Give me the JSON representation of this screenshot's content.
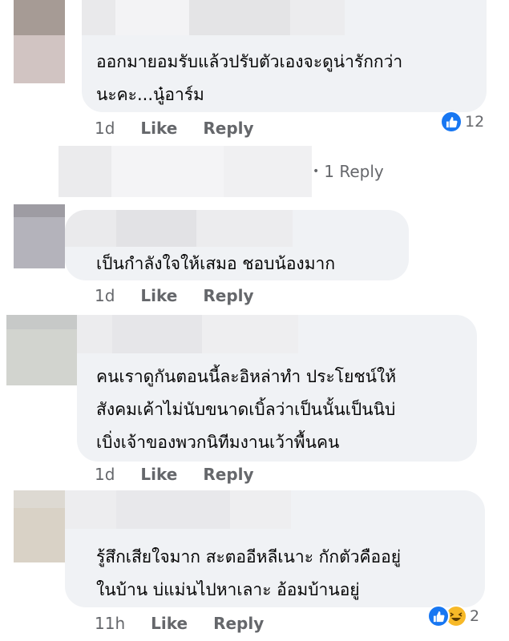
{
  "comments": [
    {
      "text_lines": [
        "ออกมายอมรับแล้วปรับตัวเองจะดูน่ารักกว่า",
        "นะคะ...นู๋อาร์ม"
      ],
      "time": "1d",
      "like_label": "Like",
      "reply_label": "Reply",
      "reactions": [
        "like"
      ],
      "reaction_count": "12",
      "view_replies": "1 Reply"
    },
    {
      "text_lines": [
        "เป็นกำลังใจให้เสมอ ชอบน้องมาก"
      ],
      "time": "1d",
      "like_label": "Like",
      "reply_label": "Reply"
    },
    {
      "text_lines": [
        "คนเราดูกันตอนนี้ละอิหล่าทำ ประโยชน์ให้",
        "สังคมเค้าไม่นับขนาดเบิ้ลว่าเป็นนั้นเป็นนิบ่",
        "เบิ่งเจ้าของพวกนิทีมงานเว้าพื้นคน"
      ],
      "time": "1d",
      "like_label": "Like",
      "reply_label": "Reply"
    },
    {
      "text_lines": [
        "รู้สึกเสียใจมาก สะตออีหลีเนาะ กักตัวคืออยู่",
        "ในบ้าน บ่แม่นไปหาเลาะ อ้อมบ้านอยู่"
      ],
      "time": "11h",
      "like_label": "Like",
      "reply_label": "Reply",
      "reactions": [
        "like",
        "haha"
      ],
      "reaction_count": "2"
    }
  ],
  "colors": {
    "bubble": "#f0f2f5",
    "like_blue": "#1877f2",
    "haha_yellow": "#f7b928",
    "meta_gray": "#65676b"
  }
}
